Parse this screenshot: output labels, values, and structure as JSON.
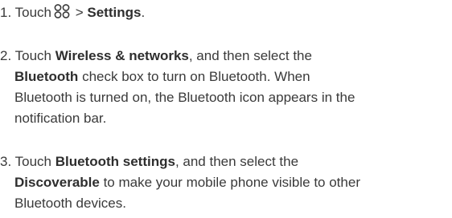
{
  "steps": [
    {
      "number": "1.",
      "before_icon": "Touch",
      "icon": "apps-launcher-icon",
      "after_icon": ">",
      "bold_1": "Settings",
      "end": "."
    },
    {
      "number": "2.",
      "text_1": "Touch",
      "bold_1": "Wireless & networks",
      "text_2": ", and then select the",
      "bold_2": "Bluetooth",
      "text_3": "check box to turn on Bluetooth. When",
      "text_4": "Bluetooth is turned on, the Bluetooth icon appears in the",
      "text_5": "notification bar."
    },
    {
      "number": "3.",
      "text_1": "Touch",
      "bold_1": "Bluetooth settings",
      "text_2": ", and then select the",
      "bold_2": "Discoverable",
      "text_3": "to make your mobile phone visible to other",
      "text_4": "Bluetooth devices."
    }
  ]
}
